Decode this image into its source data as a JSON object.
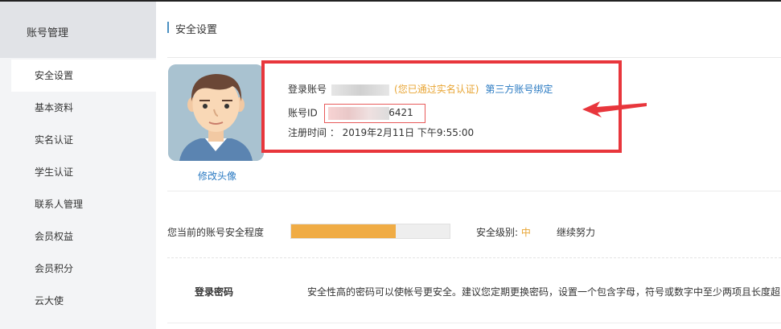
{
  "sidebar": {
    "title": "账号管理",
    "items": [
      {
        "label": "安全设置",
        "active": true
      },
      {
        "label": "基本资料",
        "active": false
      },
      {
        "label": "实名认证",
        "active": false
      },
      {
        "label": "学生认证",
        "active": false
      },
      {
        "label": "联系人管理",
        "active": false
      },
      {
        "label": "会员权益",
        "active": false
      },
      {
        "label": "会员积分",
        "active": false
      },
      {
        "label": "云大使",
        "active": false
      }
    ]
  },
  "main": {
    "title": "安全设置",
    "avatar_link": "修改头像",
    "account": {
      "login_label": "登录账号",
      "verified_text": "(您已通过实名认证)",
      "bind_link": "第三方账号绑定",
      "id_label": "账号ID",
      "id_visible_suffix": "6421",
      "reg_label": "注册时间 ：",
      "reg_time": "2019年2月11日 下午9:55:00"
    },
    "security": {
      "label": "您当前的账号安全程度",
      "progress": 0.66,
      "level_label": "安全级别:",
      "level_value": "中",
      "encourage": "继续努力"
    },
    "password": {
      "label": "登录密码",
      "desc": "安全性高的密码可以使帐号更安全。建议您定期更换密码，设置一个包含字母，符号或数字中至少两项且长度超"
    }
  },
  "colors": {
    "accent_blue": "#2a7ac2",
    "warning_orange": "#e8a534",
    "highlight_red": "#e8363c",
    "progress_fill": "#f0ac45"
  }
}
